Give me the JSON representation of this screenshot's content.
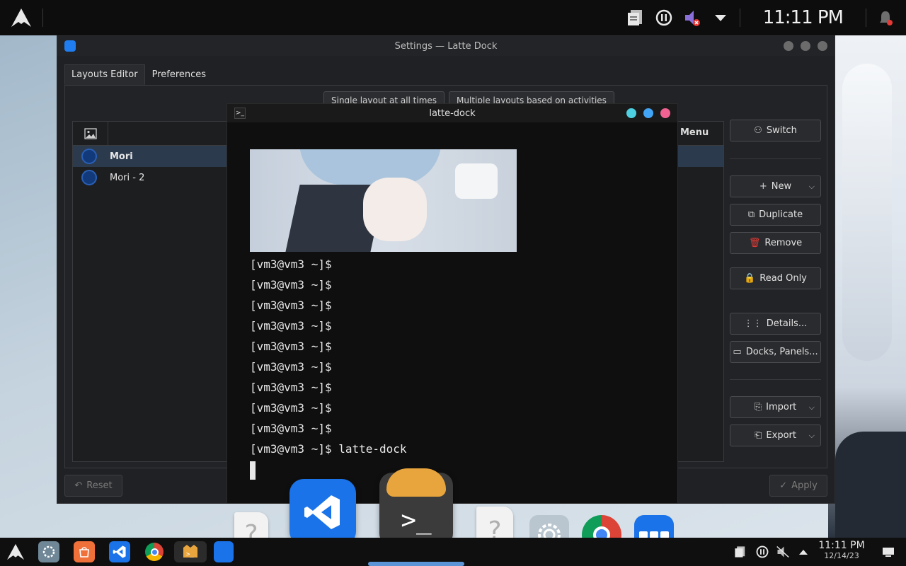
{
  "top_panel": {
    "launcher_icon": "arch-logo-icon",
    "tray_icons": [
      "clipboard-icon",
      "pause-icon",
      "muted-audio-icon",
      "chevron-down-icon"
    ],
    "clock": "11:11 PM",
    "notification_icon": "bell-icon"
  },
  "settings": {
    "title": "Settings — Latte Dock",
    "tabs": [
      "Layouts Editor",
      "Preferences"
    ],
    "layout_modes": [
      "Single layout at all times",
      "Multiple layouts based on activities"
    ],
    "table_header_menu": "Menu",
    "layouts": [
      {
        "name": "Mori",
        "selected": true
      },
      {
        "name": "Mori - 2",
        "selected": false
      }
    ],
    "buttons": {
      "switch": "Switch",
      "new": "New",
      "duplicate": "Duplicate",
      "remove": "Remove",
      "read_only": "Read Only",
      "details": "Details...",
      "docks_panels": "Docks, Panels...",
      "import": "Import",
      "export": "Export",
      "reset": "Reset",
      "apply": "Apply"
    }
  },
  "terminal": {
    "title": "latte-dock",
    "prompt": "[vm3@vm3 ~]$",
    "lines": [
      "[vm3@vm3 ~]$",
      "[vm3@vm3 ~]$",
      "[vm3@vm3 ~]$",
      "[vm3@vm3 ~]$",
      "[vm3@vm3 ~]$",
      "[vm3@vm3 ~]$",
      "[vm3@vm3 ~]$",
      "[vm3@vm3 ~]$",
      "[vm3@vm3 ~]$",
      "[vm3@vm3 ~]$ latte-dock"
    ]
  },
  "dock": {
    "items": [
      "unknown-file-icon",
      "vscode-icon",
      "terminal-icon",
      "unknown-file-icon",
      "system-settings-icon",
      "chrome-icon",
      "latte-dock-icon"
    ],
    "unknown_glyph": "?"
  },
  "bottom_panel": {
    "launchers": [
      "arch-logo-icon",
      "settings-icon",
      "software-center-icon",
      "vscode-icon",
      "chrome-icon",
      "terminal-icon",
      "latte-dock-icon"
    ],
    "tray": [
      "clipboard-icon",
      "pause-icon",
      "muted-audio-icon",
      "chevron-up-icon"
    ],
    "time": "11:11 PM",
    "date": "12/14/23",
    "show_desktop_icon": "show-desktop-icon"
  },
  "colors": {
    "accent": "#1a73e8",
    "terminal_close": "#f06292",
    "terminal_max": "#42a5f5",
    "terminal_min": "#4dd0e1"
  }
}
